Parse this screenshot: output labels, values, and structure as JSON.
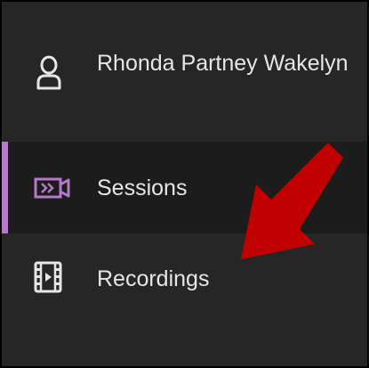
{
  "sidebar": {
    "user": {
      "name": "Rhonda Partney Wakelyn",
      "icon": "user-icon"
    },
    "items": [
      {
        "label": "Sessions",
        "icon": "sessions-video-icon",
        "active": true,
        "accent_color": "#b679c9"
      },
      {
        "label": "Recordings",
        "icon": "film-recording-icon",
        "active": false
      }
    ]
  },
  "annotation": {
    "arrow_color": "#c00000",
    "points_to": "Recordings"
  },
  "colors": {
    "background": "#262626",
    "active_background": "#1c1c1c",
    "text": "#e6e6e6"
  }
}
